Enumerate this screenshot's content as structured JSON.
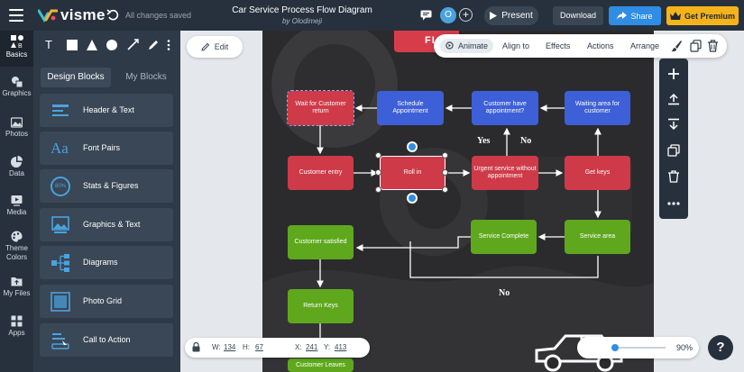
{
  "app": {
    "logo_text": "visme",
    "save_status": "All changes saved",
    "doc_title": "Car Service Process Flow Diagram",
    "doc_author": "by Olodimeji"
  },
  "header": {
    "avatar_letter": "O",
    "add_collaborator": "+",
    "present_label": "Present",
    "download_label": "Download",
    "share_label": "Share",
    "premium_label": "Get Premium"
  },
  "rail": {
    "items": [
      {
        "label": "Basics"
      },
      {
        "label": "Graphics"
      },
      {
        "label": "Photos"
      },
      {
        "label": "Data"
      },
      {
        "label": "Media"
      },
      {
        "label": "Theme Colors"
      },
      {
        "label": "My Files"
      },
      {
        "label": "Apps"
      }
    ]
  },
  "panel": {
    "tools": [
      "T"
    ],
    "tabs": [
      {
        "label": "Design Blocks"
      },
      {
        "label": "My Blocks"
      }
    ],
    "blocks": [
      {
        "label": "Header & Text"
      },
      {
        "label": "Font Pairs",
        "icon_text": "Aa"
      },
      {
        "label": "Stats & Figures",
        "icon_text": "80%"
      },
      {
        "label": "Graphics & Text"
      },
      {
        "label": "Diagrams"
      },
      {
        "label": "Photo Grid"
      },
      {
        "label": "Call to Action"
      }
    ]
  },
  "canvas": {
    "edit_label": "Edit",
    "title_pill": "FL",
    "nodes": {
      "wait_customer": "Wait for Customer return",
      "schedule": "Schedule Appointment",
      "customer_have": "Customer have appointment?",
      "waiting_area": "Waiting area for customer",
      "customer_entry": "Customer entry",
      "roll_in": "Roll in",
      "urgent_service": "Urgent service without appointment",
      "get_keys": "Get keys",
      "customer_satisfied": "Customer satisfied",
      "service_complete": "Service Complete",
      "service_area": "Service area",
      "return_keys": "Return Keys",
      "customer_leaves": "Customer Leaves"
    },
    "labels": {
      "yes": "Yes",
      "no_top": "No",
      "no_bottom": "No"
    }
  },
  "context_toolbar": {
    "animate": "Animate",
    "align": "Align to",
    "effects": "Effects",
    "actions": "Actions",
    "arrange": "Arrange"
  },
  "status": {
    "w_label": "W:",
    "w_value": "134",
    "h_label": "H:",
    "h_value": "67",
    "x_label": "X:",
    "x_value": "241",
    "y_label": "Y:",
    "y_value": "413",
    "zoom": "90%",
    "zoom_fraction": 0.9,
    "help": "?"
  },
  "colors": {
    "node_red": "#cf3a48",
    "node_blue": "#3d5fd7",
    "node_green": "#5fa81e",
    "share_blue": "#2f8de4",
    "premium_yellow": "#f5b31b",
    "dark_chrome": "#27313d"
  }
}
